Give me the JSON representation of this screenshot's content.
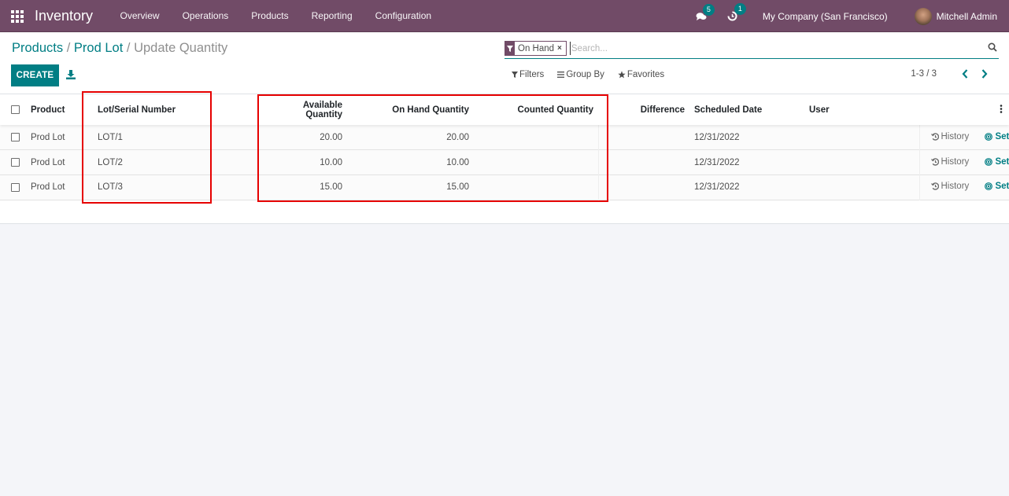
{
  "navbar": {
    "app_name": "Inventory",
    "menu": [
      "Overview",
      "Operations",
      "Products",
      "Reporting",
      "Configuration"
    ],
    "messages_count": "5",
    "activities_count": "1",
    "company": "My Company (San Francisco)",
    "user": "Mitchell Admin"
  },
  "breadcrumb": {
    "items": [
      "Products",
      "Prod Lot"
    ],
    "separator": "/",
    "current": "Update Quantity"
  },
  "toolbar": {
    "create_label": "CREATE"
  },
  "search": {
    "facet_label": "On Hand",
    "facet_remove": "×",
    "placeholder": "Search...",
    "filters_label": "Filters",
    "groupby_label": "Group By",
    "favorites_label": "Favorites"
  },
  "pager": {
    "value": "1-3 / 3"
  },
  "table": {
    "columns": [
      "Product",
      "Lot/Serial Number",
      "Available Quantity",
      "On Hand Quantity",
      "Counted Quantity",
      "Difference",
      "Scheduled Date",
      "User"
    ],
    "history_label": "History",
    "set_label": "Set",
    "rows": [
      {
        "product": "Prod Lot",
        "lot": "LOT/1",
        "available": "20.00",
        "on_hand": "20.00",
        "counted": "",
        "difference": "",
        "date": "12/31/2022",
        "user": ""
      },
      {
        "product": "Prod Lot",
        "lot": "LOT/2",
        "available": "10.00",
        "on_hand": "10.00",
        "counted": "",
        "difference": "",
        "date": "12/31/2022",
        "user": ""
      },
      {
        "product": "Prod Lot",
        "lot": "LOT/3",
        "available": "15.00",
        "on_hand": "15.00",
        "counted": "",
        "difference": "",
        "date": "12/31/2022",
        "user": ""
      }
    ]
  },
  "colors": {
    "brand": "#714b67",
    "accent": "#017e84",
    "highlight": "#e60000"
  }
}
